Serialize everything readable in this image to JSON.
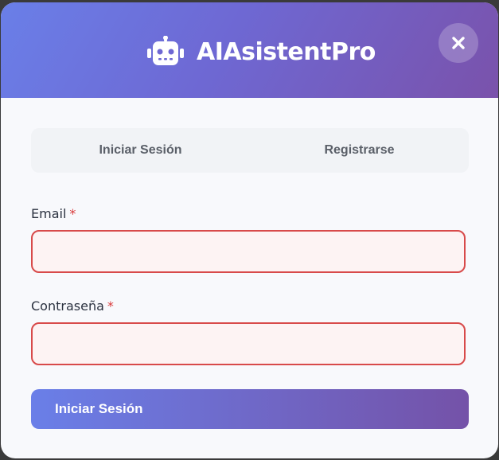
{
  "header": {
    "title": "AIAsistentPro",
    "brand_icon": "robot-icon",
    "close_icon": "close-icon"
  },
  "tabs": [
    {
      "label": "Iniciar Sesión"
    },
    {
      "label": "Registrarse"
    }
  ],
  "form": {
    "email": {
      "label": "Email",
      "required_mark": "*",
      "value": "",
      "placeholder": ""
    },
    "password": {
      "label": "Contraseña",
      "required_mark": "*",
      "value": "",
      "placeholder": ""
    },
    "submit_label": "Iniciar Sesión"
  },
  "colors": {
    "gradient_start": "#6a7fe8",
    "gradient_end": "#7a52ab",
    "error_border": "#d84a4a",
    "error_fill": "#fdf3f3",
    "required": "#d93a3a"
  }
}
